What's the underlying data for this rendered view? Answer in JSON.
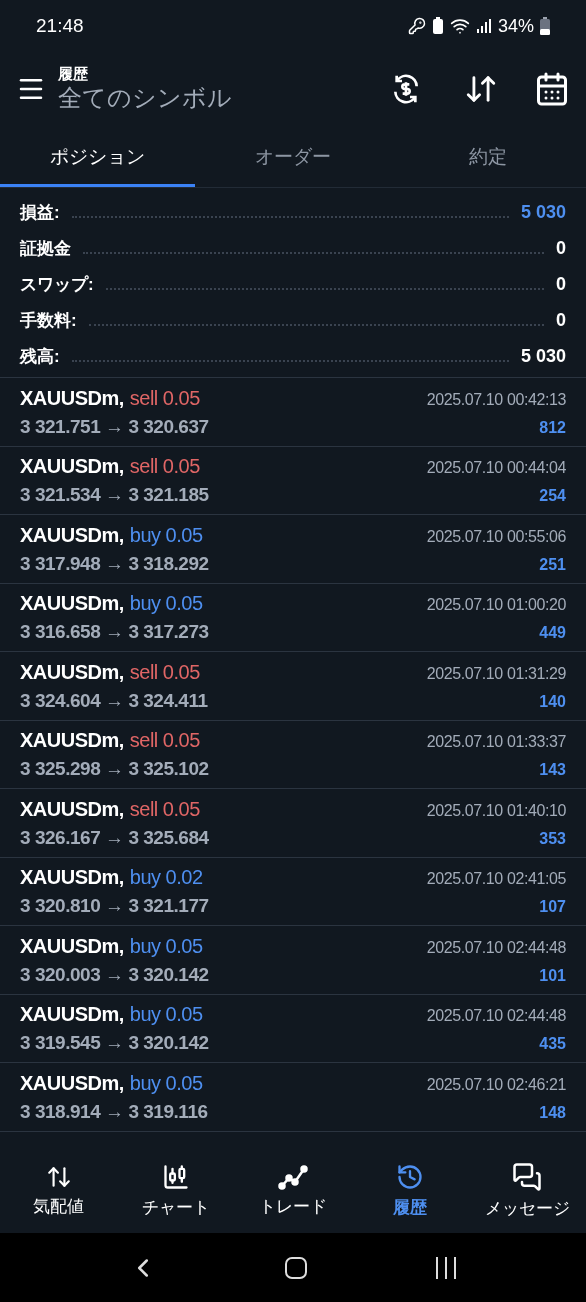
{
  "status_bar": {
    "time": "21:48",
    "battery": "34%"
  },
  "header": {
    "subtitle": "履歴",
    "title": "全てのシンボル"
  },
  "tabs": [
    {
      "label": "ポジション",
      "selected": true
    },
    {
      "label": "オーダー",
      "selected": false
    },
    {
      "label": "約定",
      "selected": false
    }
  ],
  "summary": [
    {
      "label": "損益:",
      "value": "5 030",
      "highlight": true
    },
    {
      "label": "証拠金",
      "value": "0",
      "highlight": false
    },
    {
      "label": "スワップ:",
      "value": "0",
      "highlight": false
    },
    {
      "label": "手数料:",
      "value": "0",
      "highlight": false
    },
    {
      "label": "残高:",
      "value": "5 030",
      "highlight": false
    }
  ],
  "trades": [
    {
      "symbol": "XAUUSDm,",
      "side": "sell",
      "volume": "0.05",
      "prices": "3 321.751 → 3 320.637",
      "time": "2025.07.10 00:42:13",
      "profit": "812"
    },
    {
      "symbol": "XAUUSDm,",
      "side": "sell",
      "volume": "0.05",
      "prices": "3 321.534 → 3 321.185",
      "time": "2025.07.10 00:44:04",
      "profit": "254"
    },
    {
      "symbol": "XAUUSDm,",
      "side": "buy",
      "volume": "0.05",
      "prices": "3 317.948 → 3 318.292",
      "time": "2025.07.10 00:55:06",
      "profit": "251"
    },
    {
      "symbol": "XAUUSDm,",
      "side": "buy",
      "volume": "0.05",
      "prices": "3 316.658 → 3 317.273",
      "time": "2025.07.10 01:00:20",
      "profit": "449"
    },
    {
      "symbol": "XAUUSDm,",
      "side": "sell",
      "volume": "0.05",
      "prices": "3 324.604 → 3 324.411",
      "time": "2025.07.10 01:31:29",
      "profit": "140"
    },
    {
      "symbol": "XAUUSDm,",
      "side": "sell",
      "volume": "0.05",
      "prices": "3 325.298 → 3 325.102",
      "time": "2025.07.10 01:33:37",
      "profit": "143"
    },
    {
      "symbol": "XAUUSDm,",
      "side": "sell",
      "volume": "0.05",
      "prices": "3 326.167 → 3 325.684",
      "time": "2025.07.10 01:40:10",
      "profit": "353"
    },
    {
      "symbol": "XAUUSDm,",
      "side": "buy",
      "volume": "0.02",
      "prices": "3 320.810 → 3 321.177",
      "time": "2025.07.10 02:41:05",
      "profit": "107"
    },
    {
      "symbol": "XAUUSDm,",
      "side": "buy",
      "volume": "0.05",
      "prices": "3 320.003 → 3 320.142",
      "time": "2025.07.10 02:44:48",
      "profit": "101"
    },
    {
      "symbol": "XAUUSDm,",
      "side": "buy",
      "volume": "0.05",
      "prices": "3 319.545 → 3 320.142",
      "time": "2025.07.10 02:44:48",
      "profit": "435"
    },
    {
      "symbol": "XAUUSDm,",
      "side": "buy",
      "volume": "0.05",
      "prices": "3 318.914 → 3 319.116",
      "time": "2025.07.10 02:46:21",
      "profit": "148"
    }
  ],
  "bottom_nav": [
    {
      "label": "気配値",
      "kind": "quotes",
      "selected": false
    },
    {
      "label": "チャート",
      "kind": "chart",
      "selected": false
    },
    {
      "label": "トレード",
      "kind": "trade",
      "selected": false
    },
    {
      "label": "履歴",
      "kind": "history",
      "selected": true
    },
    {
      "label": "メッセージ",
      "kind": "messages",
      "selected": false
    }
  ]
}
